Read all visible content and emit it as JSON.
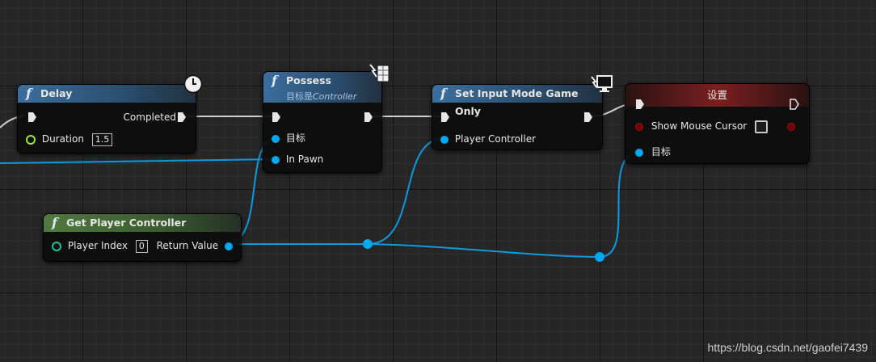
{
  "nodes": {
    "delay": {
      "title": "Delay",
      "completed": "Completed",
      "duration_label": "Duration",
      "duration_value": "1.5"
    },
    "possess": {
      "title": "Possess",
      "subtitle_prefix": "目标是",
      "subtitle_target": "Controller",
      "target_label": "目标",
      "in_pawn_label": "In Pawn"
    },
    "set_input_mode": {
      "title": "Set Input Mode Game Only",
      "player_controller_label": "Player Controller"
    },
    "set_var": {
      "title": "设置",
      "show_cursor_label": "Show Mouse Cursor",
      "target_label": "目标"
    },
    "get_pc": {
      "title": "Get Player Controller",
      "player_index_label": "Player Index",
      "player_index_value": "0",
      "return_label": "Return Value"
    }
  },
  "icons": {
    "function": "f",
    "clock": "clock-icon",
    "server": "server-only-icon",
    "monitor": "client-monitor-icon"
  },
  "colors": {
    "object_pin": "#00a8f0",
    "float_pin": "#9be73a",
    "int_pin": "#18c49a",
    "bool_pin": "#b01010",
    "exec_wire": "#d0d0d0"
  },
  "watermark": "https://blog.csdn.net/gaofei7439"
}
